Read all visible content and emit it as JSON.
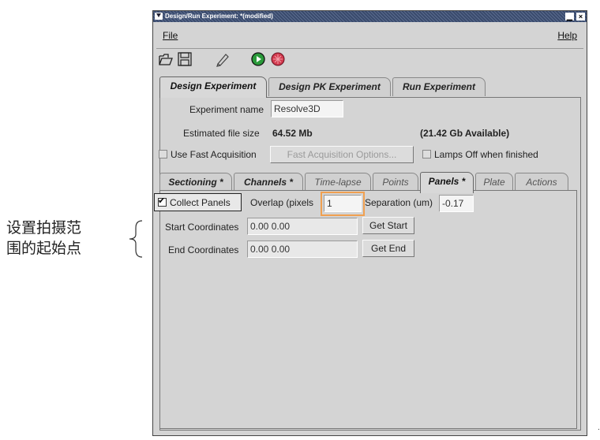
{
  "annotation": {
    "lines": [
      "设置拍摄范",
      "围的起始点"
    ]
  },
  "window": {
    "title": "Design/Run Experiment: *(modified)",
    "minimize_glyph": "▁",
    "close_glyph": "×"
  },
  "menubar": {
    "file": "File",
    "help": "Help"
  },
  "toolbar": {
    "icons": [
      "open-icon",
      "save-icon",
      "edit-icon",
      "run-icon",
      "stop-icon"
    ]
  },
  "main_tabs": [
    {
      "label": "Design Experiment",
      "active": true
    },
    {
      "label": "Design PK Experiment",
      "active": false
    },
    {
      "label": "Run Experiment",
      "active": false
    }
  ],
  "design": {
    "experiment_name_label": "Experiment name",
    "experiment_name_value": "Resolve3D",
    "file_size_label": "Estimated file size",
    "file_size_value": "64.52 Mb",
    "available": "(21.42 Gb Available)",
    "fast_acq_label": "Use Fast Acquisition",
    "fast_acq_checked": false,
    "fast_acq_options_button": "Fast Acquisition Options...",
    "lamps_off_label": "Lamps Off when finished",
    "lamps_off_checked": false
  },
  "sub_tabs": [
    {
      "label": "Sectioning *",
      "active": false
    },
    {
      "label": "Channels *",
      "active": false
    },
    {
      "label": "Time-lapse",
      "active": false
    },
    {
      "label": "Points",
      "active": false
    },
    {
      "label": "Panels *",
      "active": true
    },
    {
      "label": "Plate",
      "active": false
    },
    {
      "label": "Actions",
      "active": false
    }
  ],
  "panels": {
    "collect_label": "Collect Panels",
    "collect_checked": true,
    "overlap_label": "Overlap (pixels",
    "overlap_value": "1",
    "separation_label": "Separation (um)",
    "separation_value": "-0.17",
    "start_label": "Start Coordinates",
    "start_value": "0.00 0.00",
    "get_start": "Get Start",
    "end_label": "End Coordinates",
    "end_value": "0.00 0.00",
    "get_end": "Get End"
  },
  "colors": {
    "highlight": "#f0a050",
    "titlebar": "#4a5b7d"
  },
  "trailing_mark": "."
}
